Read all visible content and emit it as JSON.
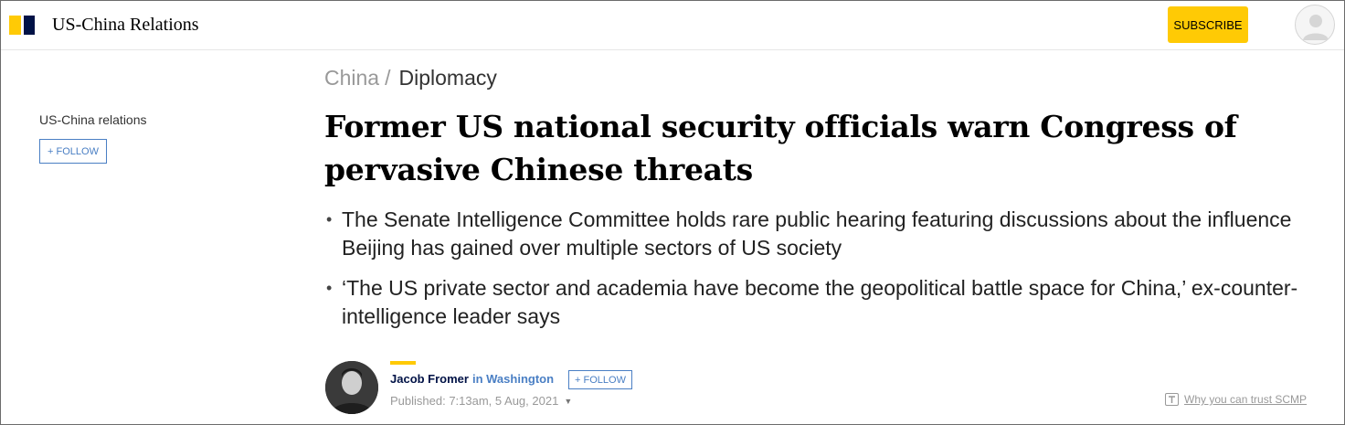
{
  "header": {
    "section_title": "US-China Relations",
    "subscribe_label": "SUBSCRIBE",
    "logo_icon": "scmp-logo-icon",
    "avatar_icon": "user-avatar-icon"
  },
  "sidebar": {
    "topic_label": "US-China relations",
    "follow_label": "+ FOLLOW"
  },
  "breadcrumb": {
    "items": [
      "China",
      "Diplomacy"
    ],
    "separator": "/"
  },
  "article": {
    "headline": "Former US national security officials warn Congress of pervasive Chinese threats",
    "summary": [
      "The Senate Intelligence Committee holds rare public hearing featuring discussions about the influence Beijing has gained over multiple sectors of US society",
      "‘The US private sector and academia have become the geopolitical battle space for China,’ ex-counter-intelligence leader says"
    ]
  },
  "author": {
    "name": "Jacob Fromer",
    "location": "in Washington",
    "follow_label": "+ FOLLOW",
    "published": "Published: 7:13am, 5 Aug, 2021",
    "caret_icon": "chevron-down-icon"
  },
  "trust": {
    "label": "Why you can trust SCMP",
    "icon": "trust-icon"
  },
  "colors": {
    "brand_yellow": "#ffca05",
    "brand_navy": "#001246",
    "link_blue": "#4a7fc4"
  }
}
